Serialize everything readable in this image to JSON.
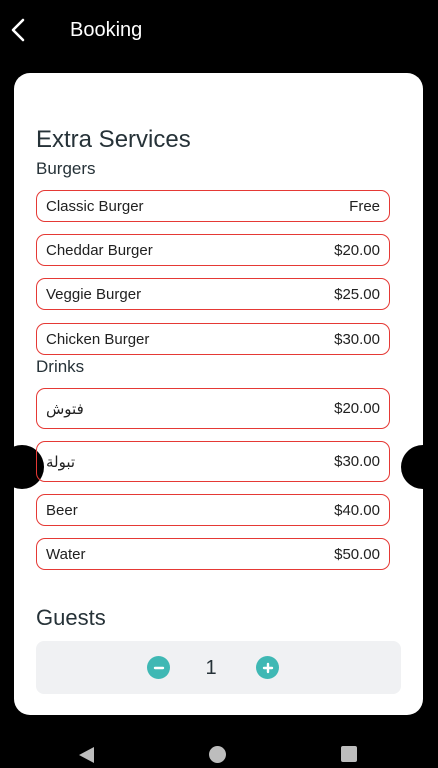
{
  "appbar": {
    "title": "Booking",
    "back_icon": "chevron-left-icon"
  },
  "extras": {
    "title": "Extra Services",
    "groups": [
      {
        "label": "Burgers",
        "items": [
          {
            "name": "Classic Burger",
            "price": "Free"
          },
          {
            "name": "Cheddar Burger",
            "price": "$20.00"
          },
          {
            "name": "Veggie Burger",
            "price": "$25.00"
          },
          {
            "name": "Chicken Burger",
            "price": "$30.00"
          }
        ]
      },
      {
        "label": "Drinks",
        "items": [
          {
            "name": "فتوش",
            "price": "$20.00"
          },
          {
            "name": "تبولة",
            "price": "$30.00"
          },
          {
            "name": "Beer",
            "price": "$40.00"
          },
          {
            "name": "Water",
            "price": "$50.00"
          }
        ]
      }
    ]
  },
  "guests": {
    "title": "Guests",
    "count": "1",
    "minus_icon": "minus-icon",
    "plus_icon": "plus-icon"
  },
  "colors": {
    "accent": "#3fb8b4",
    "item_border": "#e53935",
    "background": "#000000",
    "card": "#ffffff"
  },
  "navbar": {
    "icons": [
      "nav-back-icon",
      "nav-home-icon",
      "nav-recents-icon"
    ]
  }
}
